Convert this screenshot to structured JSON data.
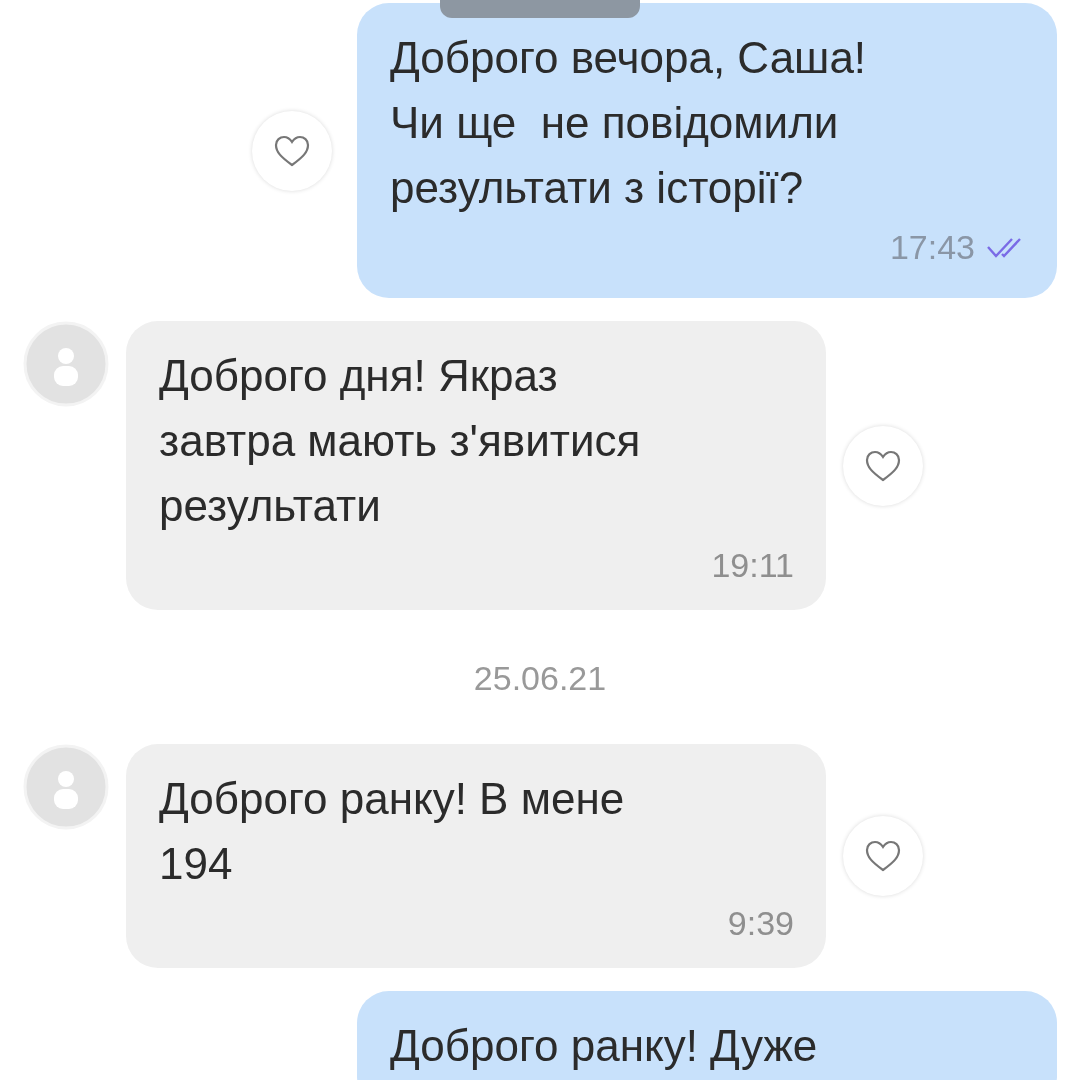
{
  "messages": [
    {
      "kind": "outgoing",
      "text": "Доброго вечора, Саша!\nЧи ще  не повідомили\nрезультати з історії?",
      "time": "17:43",
      "read": true
    },
    {
      "kind": "incoming",
      "text": "Доброго дня! Якраз\nзавтра мають з'явитися\nрезультати",
      "time": "19:11"
    },
    {
      "kind": "date",
      "text": "25.06.21"
    },
    {
      "kind": "incoming",
      "text": "Доброго ранку! В мене\n194",
      "time": "9:39"
    },
    {
      "kind": "outgoing",
      "text": "Доброго ранку! Дуже"
    }
  ]
}
